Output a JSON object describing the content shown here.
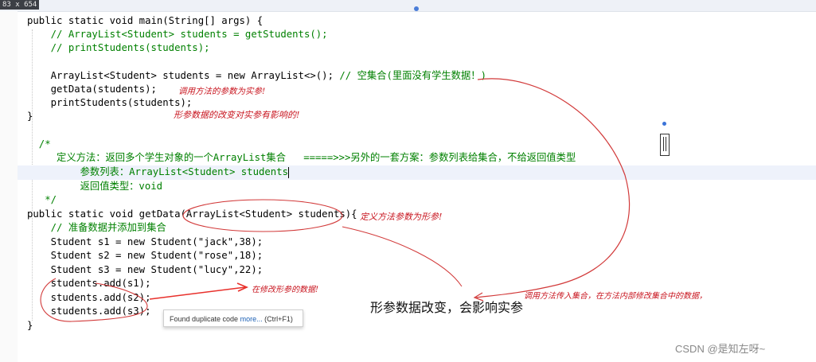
{
  "window": {
    "dimensions": "83 x 654"
  },
  "code": {
    "l1": "public static void main(String[] args) {",
    "l2": "    // ArrayList<Student> students = getStudents();",
    "l3": "    // printStudents(students);",
    "l5_code": "    ArrayList<Student> students = new ArrayList<>(); ",
    "l5_comment": "// 空集合(里面没有学生数据！)",
    "l6": "    getData(students);",
    "l7": "    printStudents(students);",
    "l8": "}",
    "l10": "  /*",
    "l11": "     定义方法：返回多个学生对象的一个ArrayList集合   =====>>>另外的一套方案：参数列表给集合，不给返回值类型",
    "l12": "         参数列表：ArrayList<Student> students",
    "l13": "         返回值类型：void",
    "l14": "   */",
    "l15": "public static void getData(ArrayList<Student> students){",
    "l16": "    // 准备数据并添加到集合",
    "l17": "    Student s1 = new Student(\"jack\",38);",
    "l18": "    Student s2 = new Student(\"rose\",18);",
    "l19": "    Student s3 = new Student(\"lucy\",22);",
    "l20": "    students.add(s1);",
    "l21": "    students.add(s2);",
    "l22": "    students.add(s3);",
    "l23": "}"
  },
  "annotations": {
    "a1": "调用方法的参数为实参!",
    "a2": "形参数据的改变对实参有影响的!",
    "a3": "定义方法参数为形参!",
    "a4": "在修改形参的数据!",
    "a5": "调用方法传入集合，在方法内部修改集合中的数据，",
    "big_note": "形参数据改变，会影响实参"
  },
  "tooltip": {
    "prefix": "Found duplicate code ",
    "link": "more...",
    "shortcut": " (Ctrl+F1)"
  },
  "watermark": "CSDN @是知左呀~"
}
